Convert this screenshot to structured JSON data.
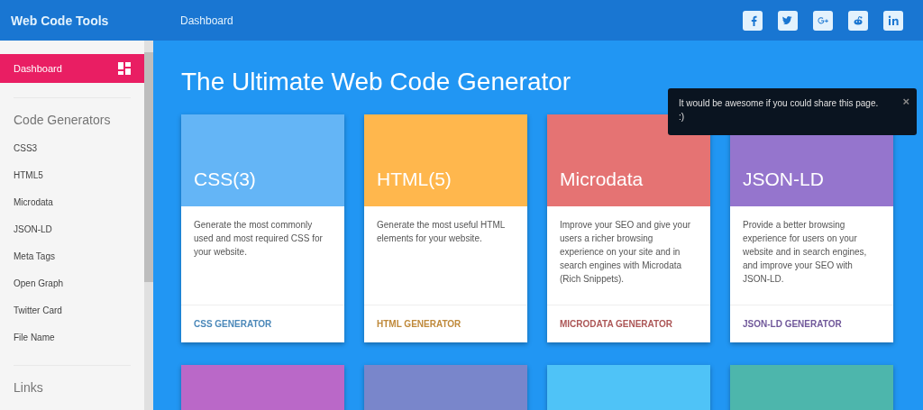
{
  "header": {
    "brand": "Web Code Tools",
    "breadcrumb": "Dashboard",
    "social": [
      {
        "kind": "facebook"
      },
      {
        "kind": "twitter"
      },
      {
        "kind": "googleplus"
      },
      {
        "kind": "reddit"
      },
      {
        "kind": "linkedin"
      }
    ]
  },
  "sidebar": {
    "items": [
      {
        "label": "Dashboard",
        "selected": true
      }
    ],
    "sections": [
      {
        "title": "Code Generators",
        "items": [
          {
            "label": "CSS3",
            "selected": false
          },
          {
            "label": "HTML5",
            "selected": false
          },
          {
            "label": "Microdata",
            "selected": false
          },
          {
            "label": "JSON-LD",
            "selected": false
          },
          {
            "label": "Meta Tags",
            "selected": false
          },
          {
            "label": "Open Graph",
            "selected": false
          },
          {
            "label": "Twitter Card",
            "selected": false
          },
          {
            "label": "File Name",
            "selected": false
          }
        ]
      },
      {
        "title": "Links"
      }
    ]
  },
  "main": {
    "title": "The Ultimate Web Code Generator",
    "cards": [
      {
        "title": "CSS(3)",
        "color": "#64b5f6",
        "description": "Generate the most commonly used and most required CSS for your website.",
        "link": "CSS GENERATOR"
      },
      {
        "title": "HTML(5)",
        "color": "#ffb74d",
        "description": "Generate the most useful HTML elements for your website.",
        "link": "HTML GENERATOR"
      },
      {
        "title": "Microdata",
        "color": "#e57373",
        "description": "Improve your SEO and give your users a richer browsing experience on your site and in search engines with Microdata (Rich Snippets).",
        "link": "MICRODATA GENERATOR"
      },
      {
        "title": "JSON-LD",
        "color": "#9575cd",
        "description": "Provide a better browsing experience for users on your website and in search engines, and improve your SEO with JSON-LD.",
        "link": "JSON-LD GENERATOR"
      },
      {
        "color": "#ba68c8"
      },
      {
        "color": "#7986cb"
      },
      {
        "color": "#4fc3f7"
      },
      {
        "color": "#4db6ac"
      }
    ]
  },
  "toast": {
    "message": "It would be awesome if you could share this page. :)",
    "close": "×"
  }
}
